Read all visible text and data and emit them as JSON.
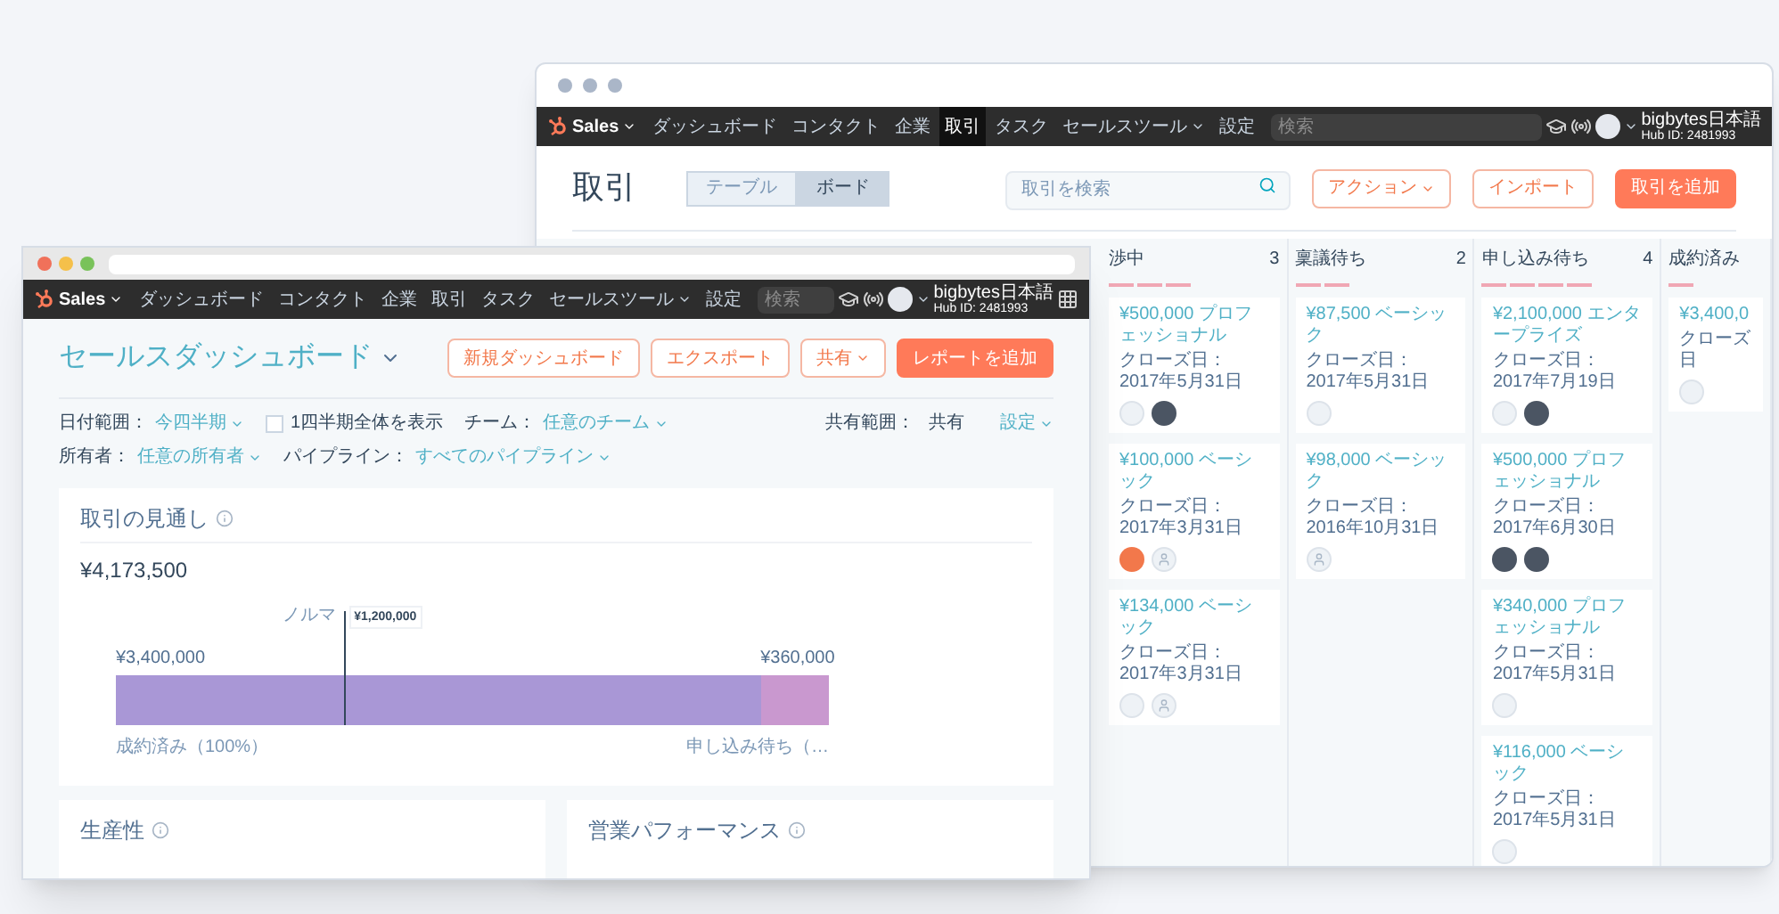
{
  "back_window": {
    "nav": {
      "brand": "Sales",
      "brand_dropdown": true,
      "items": [
        {
          "label": "ダッシュボード",
          "selected": false,
          "dropdown": false
        },
        {
          "label": "コンタクト",
          "selected": false,
          "dropdown": false
        },
        {
          "label": "企業",
          "selected": false,
          "dropdown": false
        },
        {
          "label": "取引",
          "selected": true,
          "dropdown": false
        },
        {
          "label": "タスク",
          "selected": false,
          "dropdown": false
        },
        {
          "label": "セールスツール",
          "selected": false,
          "dropdown": true
        },
        {
          "label": "設定",
          "selected": false,
          "dropdown": false
        }
      ],
      "search_placeholder": "検索",
      "account": "bigbytes日本語",
      "hub_id": "Hub ID: 2481993"
    },
    "page_title": "取引",
    "view_tabs": [
      {
        "label": "テーブル",
        "selected": false
      },
      {
        "label": "ボード",
        "selected": true
      }
    ],
    "search": {
      "placeholder": "取引を検索"
    },
    "buttons": [
      {
        "label": "アクション",
        "kind": "outline",
        "dropdown": true
      },
      {
        "label": "インポート",
        "kind": "outline",
        "dropdown": false
      },
      {
        "label": "取引を追加",
        "kind": "primary",
        "dropdown": false
      }
    ],
    "board_columns": [
      {
        "title": "渉中",
        "count": "3",
        "cards": [
          {
            "title": "¥500,000 プロフェッショナル",
            "close_date": "クローズ日： 2017年5月31日",
            "avatars": [
              {
                "kind": "empty"
              },
              {
                "kind": "photo"
              }
            ]
          },
          {
            "title": "¥100,000 ベーシック",
            "close_date": "クローズ日： 2017年3月31日",
            "avatars": [
              {
                "kind": "badge"
              },
              {
                "kind": "person"
              }
            ]
          },
          {
            "title": "¥134,000 ベーシック",
            "close_date": "クローズ日： 2017年3月31日",
            "avatars": [
              {
                "kind": "empty"
              },
              {
                "kind": "person"
              }
            ]
          }
        ]
      },
      {
        "title": "稟議待ち",
        "count": "2",
        "cards": [
          {
            "title": "¥87,500 ベーシック",
            "close_date": "クローズ日： 2017年5月31日",
            "avatars": [
              {
                "kind": "empty"
              }
            ]
          },
          {
            "title": "¥98,000 ベーシック",
            "close_date": "クローズ日： 2016年10月31日",
            "avatars": [
              {
                "kind": "person"
              }
            ]
          }
        ]
      },
      {
        "title": "申し込み待ち",
        "count": "4",
        "cards": [
          {
            "title": "¥2,100,000 エンタープライズ",
            "close_date": "クローズ日： 2017年7月19日",
            "avatars": [
              {
                "kind": "empty"
              },
              {
                "kind": "photo"
              }
            ]
          },
          {
            "title": "¥500,000 プロフェッショナル",
            "close_date": "クローズ日： 2017年6月30日",
            "avatars": [
              {
                "kind": "photo"
              },
              {
                "kind": "photo"
              }
            ]
          },
          {
            "title": "¥340,000 プロフェッショナル",
            "close_date": "クローズ日： 2017年5月31日",
            "avatars": [
              {
                "kind": "empty"
              }
            ]
          },
          {
            "title": "¥116,000 ベーシック",
            "close_date": "クローズ日： 2017年5月31日",
            "avatars": [
              {
                "kind": "empty"
              }
            ]
          }
        ]
      },
      {
        "title": "成約済み",
        "cards": [
          {
            "title": "¥3,400,0",
            "close_date": "クローズ日",
            "avatars": [
              {
                "kind": "empty"
              }
            ]
          }
        ]
      }
    ]
  },
  "front_window": {
    "nav": {
      "brand": "Sales",
      "brand_dropdown": true,
      "items": [
        {
          "label": "ダッシュボード",
          "selected": false,
          "dropdown": false
        },
        {
          "label": "コンタクト",
          "selected": false,
          "dropdown": false
        },
        {
          "label": "企業",
          "selected": false,
          "dropdown": false
        },
        {
          "label": "取引",
          "selected": false,
          "dropdown": false
        },
        {
          "label": "タスク",
          "selected": false,
          "dropdown": false
        },
        {
          "label": "セールスツール",
          "selected": false,
          "dropdown": true
        },
        {
          "label": "設定",
          "selected": false,
          "dropdown": false
        }
      ],
      "search_placeholder": "検索",
      "account": "bigbytes日本語",
      "hub_id": "Hub ID: 2481993"
    },
    "page_title": "セールスダッシュボード",
    "buttons": [
      {
        "label": "新規ダッシュボード",
        "kind": "outline",
        "dropdown": false
      },
      {
        "label": "エクスポート",
        "kind": "outline",
        "dropdown": false
      },
      {
        "label": "共有",
        "kind": "outline",
        "dropdown": true
      },
      {
        "label": "レポートを追加",
        "kind": "primary",
        "dropdown": false
      }
    ],
    "filters": [
      {
        "kind": "select",
        "label": "日付範囲：",
        "value": "今四半期"
      },
      {
        "kind": "checkbox",
        "label": "1四半期全体を表示",
        "checked": false
      },
      {
        "kind": "select",
        "label": "チーム：",
        "value": "任意のチーム"
      },
      {
        "kind": "select",
        "label": "所有者：",
        "value": "任意の所有者"
      },
      {
        "kind": "select",
        "label": "パイプライン：",
        "value": "すべてのパイプライン"
      }
    ],
    "sharing": {
      "label": "共有範囲：",
      "value": "共有",
      "settings": "設定"
    },
    "forecast": {
      "title": "取引の見通し",
      "total": "¥4,173,500",
      "segments": [
        {
          "name": "成約済み（100%）",
          "amount": "¥3,400,000",
          "color": "#a997d6",
          "level": 0.904
        },
        {
          "name": "申し込み待ち（…",
          "amount": "¥360,000",
          "color": "#c998cf",
          "level": 0.096
        }
      ],
      "quota": {
        "label": "ノルマ",
        "amount": "¥1,200,000",
        "level": 0.319
      }
    },
    "bottom_cards": [
      "生産性",
      "営業パフォーマンス"
    ]
  }
}
